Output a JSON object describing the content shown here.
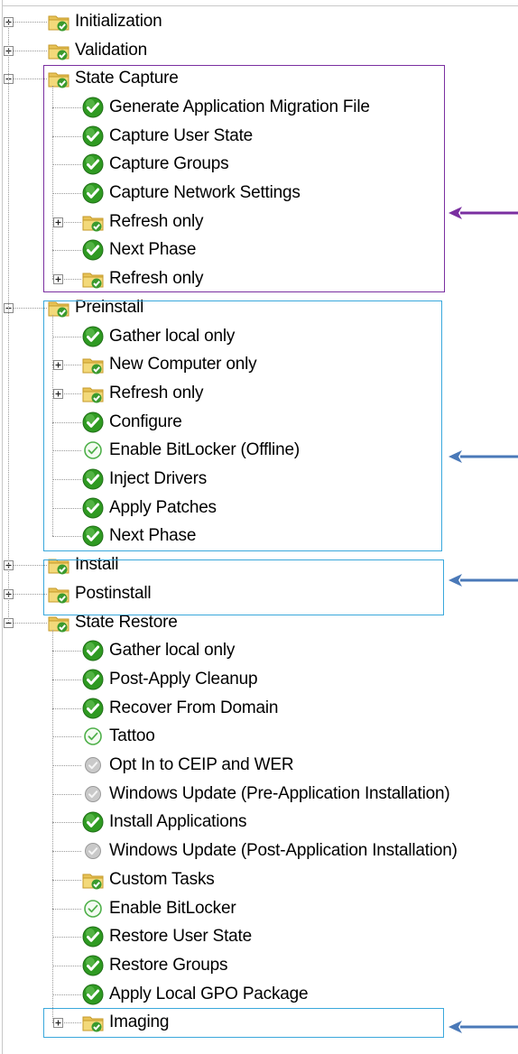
{
  "colors": {
    "purple": "#7a2fa0",
    "blue": "#3aa8dc",
    "arrow_blue": "#4a79b8"
  },
  "groups": [
    {
      "label": "Initialization",
      "state": "collapsed",
      "icon": "folder-check-icon"
    },
    {
      "label": "Validation",
      "state": "collapsed",
      "icon": "folder-check-icon"
    },
    {
      "label": "State Capture",
      "state": "expanded",
      "icon": "folder-check-icon",
      "children": [
        {
          "label": "Generate Application Migration File",
          "icon": "green-check-icon"
        },
        {
          "label": "Capture User State",
          "icon": "green-check-icon"
        },
        {
          "label": "Capture Groups",
          "icon": "green-check-icon"
        },
        {
          "label": "Capture Network Settings",
          "icon": "green-check-icon"
        },
        {
          "label": "Refresh only",
          "icon": "folder-check-icon",
          "state": "collapsed"
        },
        {
          "label": "Next Phase",
          "icon": "green-check-icon"
        },
        {
          "label": "Refresh only",
          "icon": "folder-check-icon",
          "state": "collapsed"
        }
      ]
    },
    {
      "label": "Preinstall",
      "state": "expanded",
      "icon": "folder-check-icon",
      "children": [
        {
          "label": "Gather local only",
          "icon": "green-check-icon"
        },
        {
          "label": "New Computer only",
          "icon": "folder-check-icon",
          "state": "collapsed"
        },
        {
          "label": "Refresh only",
          "icon": "folder-check-icon",
          "state": "collapsed"
        },
        {
          "label": "Configure",
          "icon": "green-check-icon"
        },
        {
          "label": "Enable BitLocker (Offline)",
          "icon": "light-check-icon"
        },
        {
          "label": "Inject Drivers",
          "icon": "green-check-icon"
        },
        {
          "label": "Apply Patches",
          "icon": "green-check-icon"
        },
        {
          "label": "Next Phase",
          "icon": "green-check-icon"
        }
      ]
    },
    {
      "label": "Install",
      "state": "collapsed",
      "icon": "folder-check-icon"
    },
    {
      "label": "Postinstall",
      "state": "collapsed",
      "icon": "folder-check-icon"
    },
    {
      "label": "State Restore",
      "state": "expanded",
      "icon": "folder-check-icon",
      "children": [
        {
          "label": "Gather local only",
          "icon": "green-check-icon"
        },
        {
          "label": "Post-Apply Cleanup",
          "icon": "green-check-icon"
        },
        {
          "label": "Recover From Domain",
          "icon": "green-check-icon"
        },
        {
          "label": "Tattoo",
          "icon": "light-check-icon"
        },
        {
          "label": "Opt In to CEIP and WER",
          "icon": "gray-check-icon"
        },
        {
          "label": "Windows Update (Pre-Application Installation)",
          "icon": "gray-check-icon"
        },
        {
          "label": "Install Applications",
          "icon": "green-check-icon"
        },
        {
          "label": "Windows Update (Post-Application Installation)",
          "icon": "gray-check-icon"
        },
        {
          "label": "Custom Tasks",
          "icon": "folder-check-icon"
        },
        {
          "label": "Enable BitLocker",
          "icon": "light-check-icon"
        },
        {
          "label": "Restore User State",
          "icon": "green-check-icon"
        },
        {
          "label": "Restore Groups",
          "icon": "green-check-icon"
        },
        {
          "label": "Apply Local GPO Package",
          "icon": "green-check-icon"
        },
        {
          "label": "Imaging",
          "icon": "folder-check-icon",
          "state": "collapsed"
        }
      ]
    }
  ]
}
